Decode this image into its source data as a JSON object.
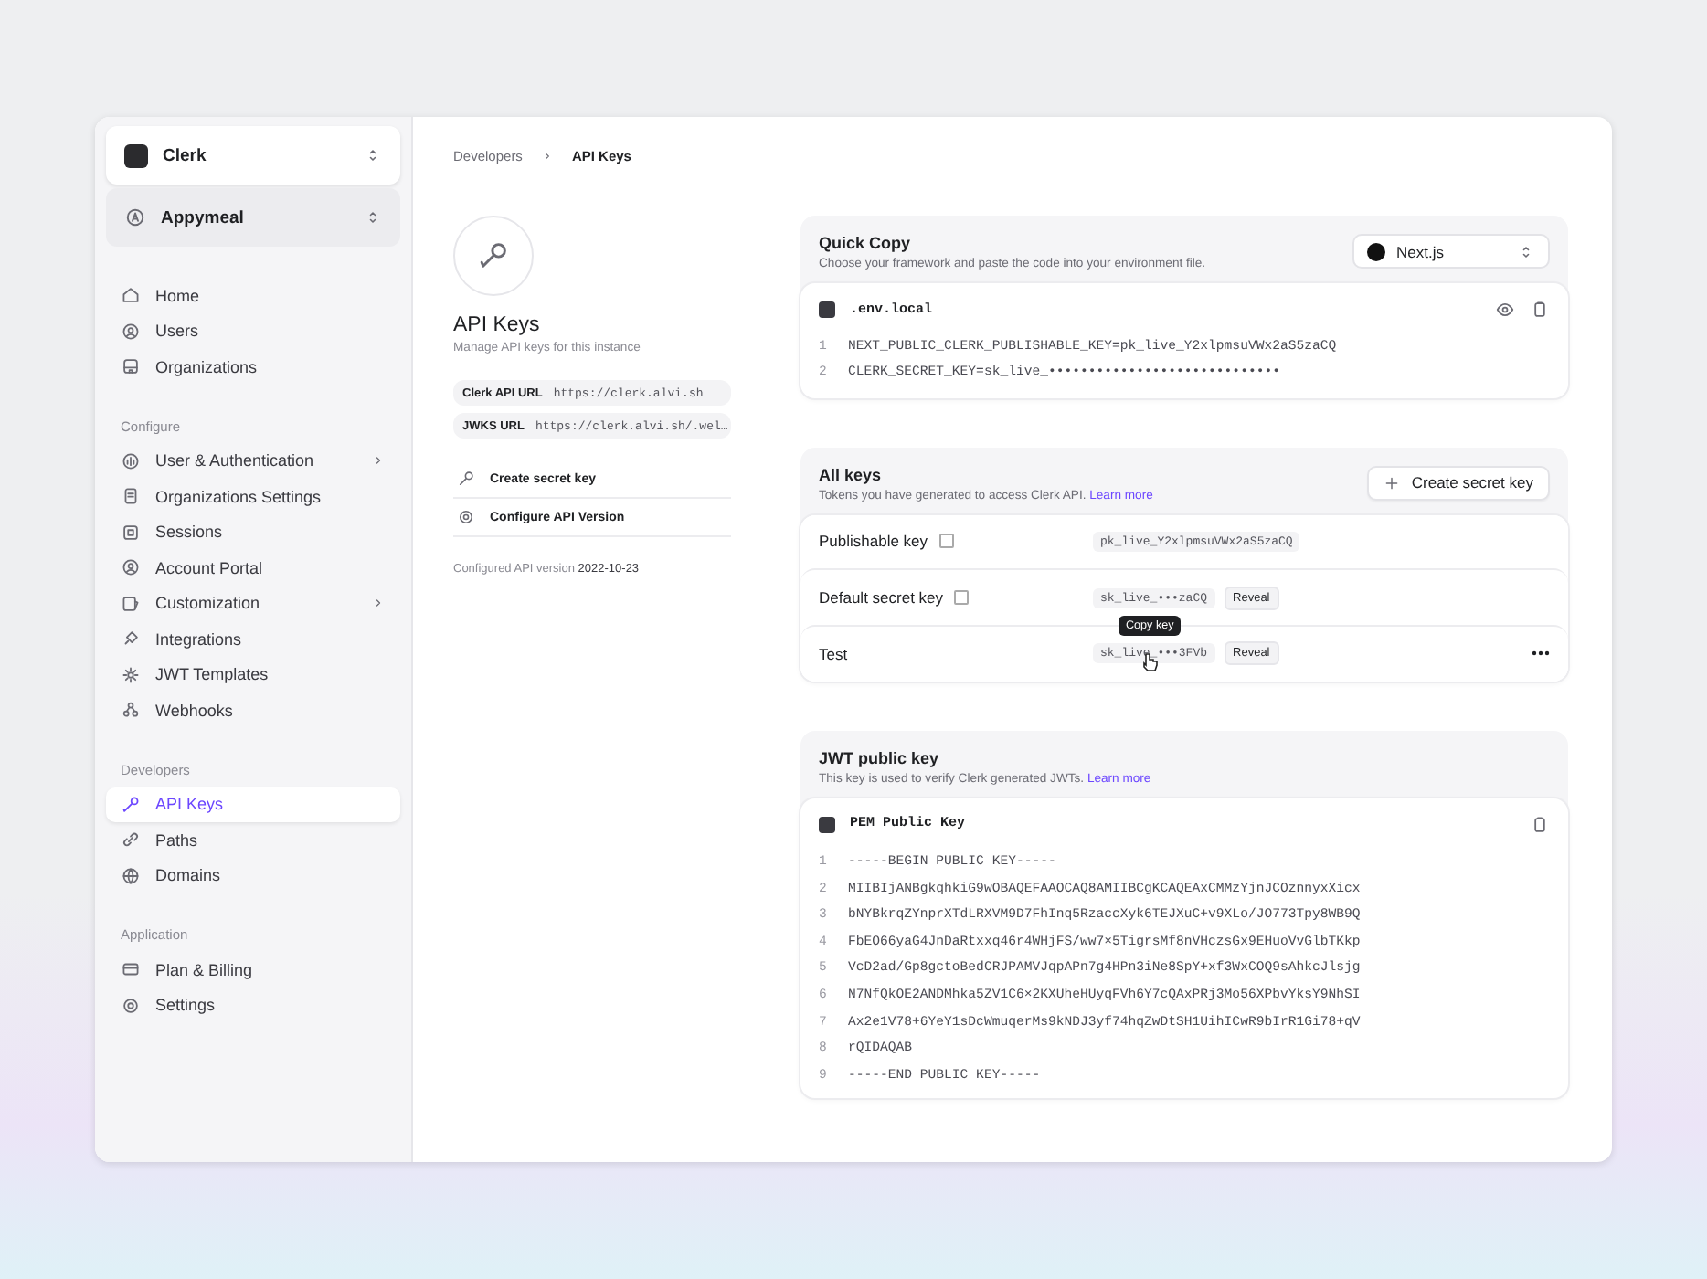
{
  "sidebar": {
    "org_switcher": {
      "name": "Clerk"
    },
    "app_switcher": {
      "name": "Appymeal"
    },
    "sections": [
      {
        "items": [
          {
            "label": "Home",
            "selected": false,
            "expandable": false
          },
          {
            "label": "Users",
            "selected": false,
            "expandable": false
          },
          {
            "label": "Organizations",
            "selected": false,
            "expandable": false
          }
        ]
      },
      {
        "title": "Configure",
        "items": [
          {
            "label": "User & Authentication",
            "selected": false,
            "expandable": true
          },
          {
            "label": "Organizations Settings",
            "selected": false,
            "expandable": false
          },
          {
            "label": "Sessions",
            "selected": false,
            "expandable": false
          },
          {
            "label": "Account Portal",
            "selected": false,
            "expandable": false
          },
          {
            "label": "Customization",
            "selected": false,
            "expandable": true
          },
          {
            "label": "Integrations",
            "selected": false,
            "expandable": false
          },
          {
            "label": "JWT Templates",
            "selected": false,
            "expandable": false
          },
          {
            "label": "Webhooks",
            "selected": false,
            "expandable": false
          }
        ]
      },
      {
        "title": "Developers",
        "items": [
          {
            "label": "API Keys",
            "selected": true,
            "expandable": false
          },
          {
            "label": "Paths",
            "selected": false,
            "expandable": false
          },
          {
            "label": "Domains",
            "selected": false,
            "expandable": false
          }
        ]
      },
      {
        "title": "Application",
        "items": [
          {
            "label": "Plan & Billing",
            "selected": false,
            "expandable": false
          },
          {
            "label": "Settings",
            "selected": false,
            "expandable": false
          }
        ]
      }
    ]
  },
  "breadcrumb": [
    "Developers",
    "API Keys"
  ],
  "intro": {
    "title": "API Keys",
    "subtitle": "Manage API keys for this instance",
    "urls": [
      {
        "label": "Clerk API URL",
        "value": "https://clerk.alvi.sh"
      },
      {
        "label": "JWKS URL",
        "value": "https://clerk.alvi.sh/.wel…"
      }
    ],
    "actions": [
      "Create secret key",
      "Configure API Version"
    ],
    "version_label": "Configured API version",
    "version": "2022-10-23"
  },
  "quick_copy": {
    "title": "Quick Copy",
    "subtitle": "Choose your framework and paste the code into your environment file.",
    "framework": "Next.js",
    "file": ".env.local",
    "lines": [
      {
        "number": "1",
        "text": "NEXT_PUBLIC_CLERK_PUBLISHABLE_KEY=pk_live_Y2xlpmsuVWx2aS5zaCQ"
      },
      {
        "number": "2",
        "text": "CLERK_SECRET_KEY=sk_live_•••••••••••••••••••••••••••••"
      }
    ]
  },
  "all_keys": {
    "title": "All keys",
    "subtitle": "Tokens you have generated to access Clerk API.",
    "link": "Learn more",
    "button": "Create secret key",
    "rows": [
      {
        "name": "Publishable key",
        "info": true,
        "key": "pk_live_Y2xlpmsuVWx2aS5zaCQ",
        "reveal": null,
        "menu": false,
        "tooltip": null
      },
      {
        "name": "Default secret key",
        "info": true,
        "key": "sk_live_•••zaCQ",
        "reveal": "Reveal",
        "menu": false,
        "tooltip": null
      },
      {
        "name": "Test",
        "info": false,
        "key": "sk_live_•••3FVb",
        "reveal": "Reveal",
        "menu": true,
        "tooltip": "Copy key"
      }
    ]
  },
  "jwt": {
    "title": "JWT public key",
    "subtitle": "This key is used to verify Clerk generated JWTs.",
    "link": "Learn more",
    "file": "PEM Public Key",
    "lines": [
      {
        "number": "1",
        "text": "-----BEGIN PUBLIC KEY-----"
      },
      {
        "number": "2",
        "text": "MIIBIjANBgkqhkiG9wOBAQEFAAOCAQ8AMIIBCgKCAQEAxCMMzYjnJCOznnyxXicx"
      },
      {
        "number": "3",
        "text": "bNYBkrqZYnprXTdLRXVM9D7FhInq5RzaccXyk6TEJXuC+v9XLo/JO773Tpy8WB9Q"
      },
      {
        "number": "4",
        "text": "FbEO66yaG4JnDaRtxxq46r4WHjFS/ww7×5TigrsMf8nVHczsGx9EHuoVvGlbTKkp"
      },
      {
        "number": "5",
        "text": "VcD2ad/Gp8gctoBedCRJPAMVJqpAPn7g4HPn3iNe8SpY+xf3WxCOQ9sAhkcJlsjg"
      },
      {
        "number": "6",
        "text": "N7NfQkOE2ANDMhka5ZV1C6×2KXUheHUyqFVh6Y7cQAxPRj3Mo56XPbvYksY9NhSI"
      },
      {
        "number": "7",
        "text": "Ax2e1V78+6YeY1sDcWmuqerMs9kNDJ3yf74hqZwDtSH1UihICwR9bIrR1Gi78+qV"
      },
      {
        "number": "8",
        "text": "rQIDAQAB"
      },
      {
        "number": "9",
        "text": "-----END PUBLIC KEY-----"
      }
    ]
  }
}
